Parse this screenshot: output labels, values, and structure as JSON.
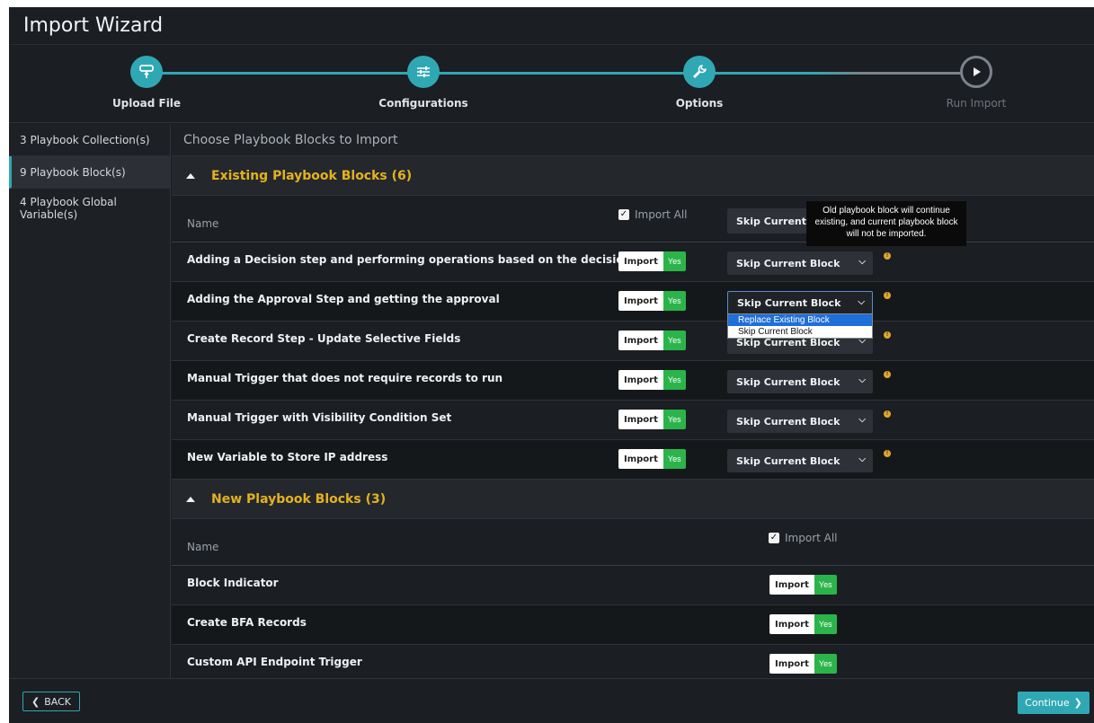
{
  "app": {
    "title": "Import Wizard"
  },
  "stepper": {
    "steps": [
      {
        "label": "Upload File",
        "icon": "upload-hand-icon",
        "state": "complete"
      },
      {
        "label": "Configurations",
        "icon": "sliders-icon",
        "state": "complete"
      },
      {
        "label": "Options",
        "icon": "wrench-icon",
        "state": "current"
      },
      {
        "label": "Run Import",
        "icon": "play-icon",
        "state": "pending"
      }
    ],
    "colors": {
      "active": "#2fa8b4",
      "pending": "#7d838a"
    }
  },
  "sidebar": {
    "items": [
      {
        "count": "3",
        "label": "Playbook Collection(s)"
      },
      {
        "count": "9",
        "label": "Playbook Block(s)"
      },
      {
        "count": "4",
        "label": "Playbook Global Variable(s)"
      }
    ]
  },
  "main": {
    "title": "Choose Playbook Blocks to Import",
    "existing": {
      "title": "Existing Playbook Blocks (6)",
      "col_name": "Name",
      "import_all": "Import All",
      "header_select": "Skip Current b",
      "tooltip": "Old playbook block will continue existing, and current playbook block will not be imported.",
      "rows": [
        {
          "name": "Adding a Decision step and performing operations based on the decision",
          "import": "Import",
          "yes": "Yes",
          "action": "Skip Current Block"
        },
        {
          "name": "Adding the Approval Step and getting the approval",
          "import": "Import",
          "yes": "Yes",
          "action": "Skip Current Block"
        },
        {
          "name": "Create Record Step - Update Selective Fields",
          "import": "Import",
          "yes": "Yes",
          "action": "Skip Current Block"
        },
        {
          "name": "Manual Trigger that does not require records to run",
          "import": "Import",
          "yes": "Yes",
          "action": "Skip Current Block"
        },
        {
          "name": "Manual Trigger with Visibility Condition Set",
          "import": "Import",
          "yes": "Yes",
          "action": "Skip Current Block"
        },
        {
          "name": "New Variable to Store IP address",
          "import": "Import",
          "yes": "Yes",
          "action": "Skip Current Block"
        }
      ],
      "dropdown_options": [
        "Replace Existing Block",
        "Skip Current Block"
      ]
    },
    "new": {
      "title": "New Playbook Blocks (3)",
      "col_name": "Name",
      "import_all": "Import All",
      "rows": [
        {
          "name": "Block Indicator",
          "import": "Import",
          "yes": "Yes"
        },
        {
          "name": "Create BFA Records",
          "import": "Import",
          "yes": "Yes"
        },
        {
          "name": "Custom API Endpoint Trigger",
          "import": "Import",
          "yes": "Yes"
        }
      ]
    }
  },
  "footer": {
    "back": "BACK",
    "continue": "Continue"
  },
  "colors": {
    "accent": "#2fa8b4",
    "section_title": "#e4b21f",
    "toggle_yes": "#2bb44a",
    "info": "#e1a82c"
  }
}
